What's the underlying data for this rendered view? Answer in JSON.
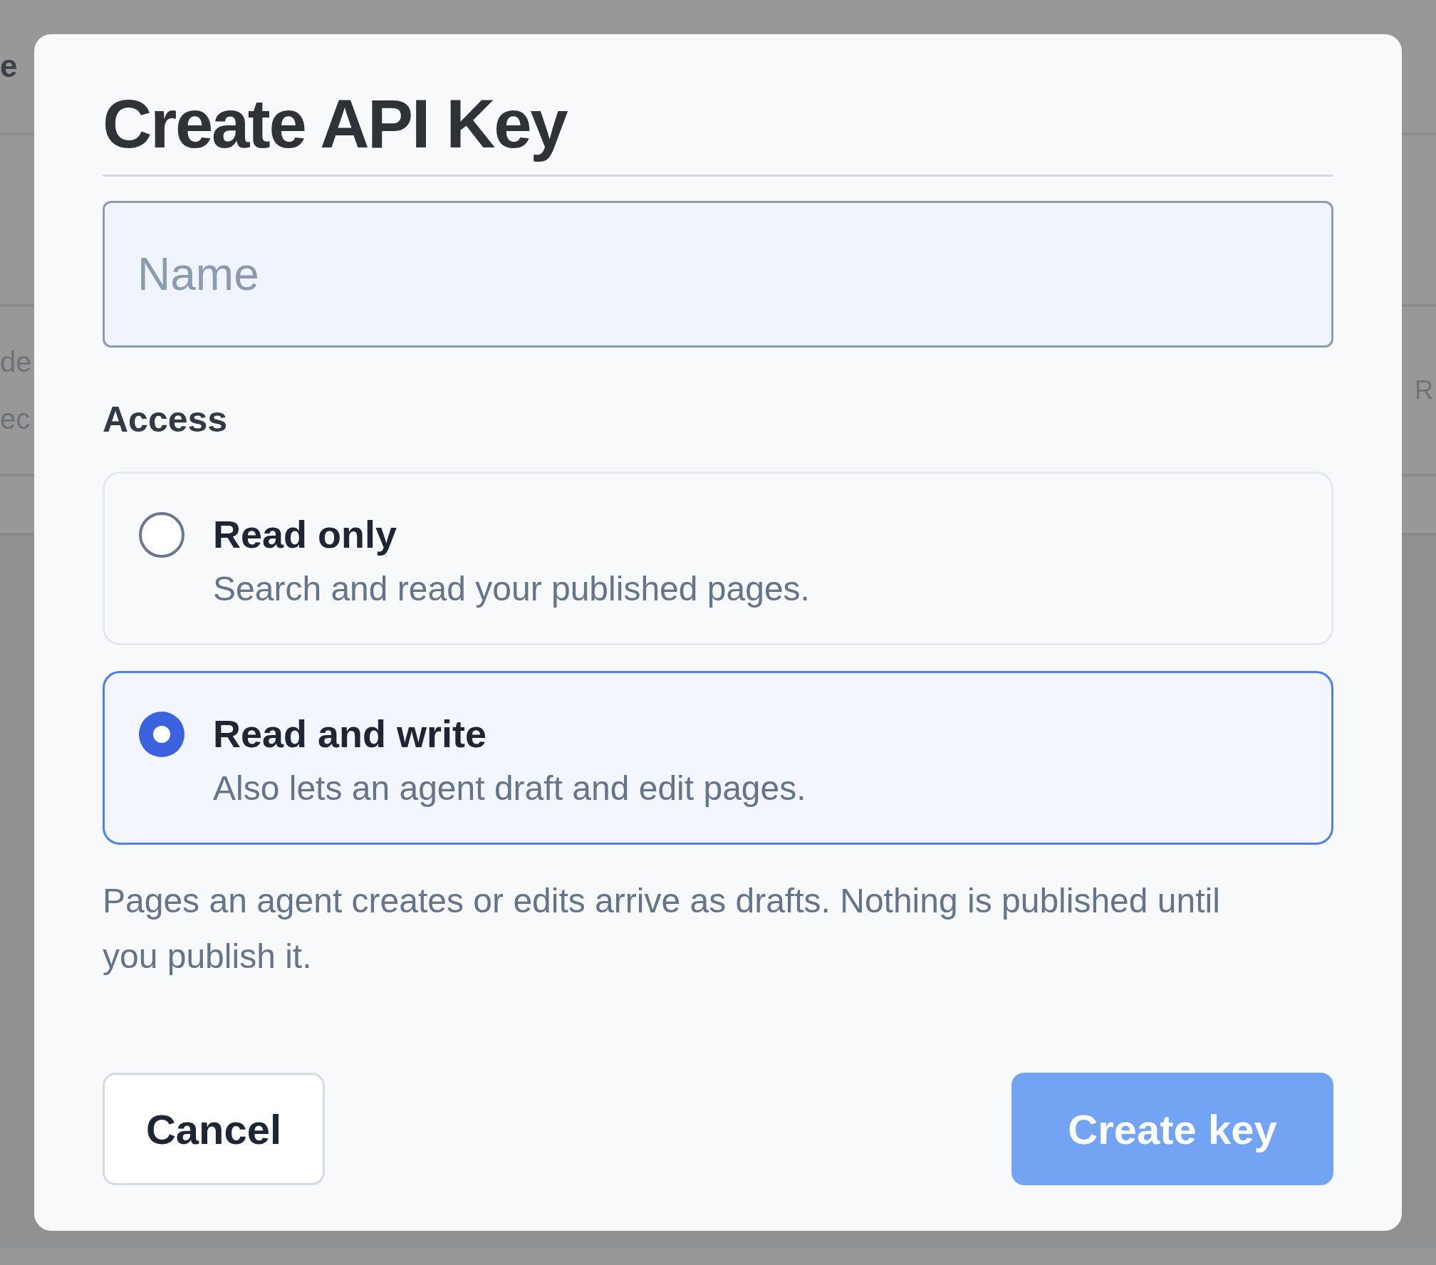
{
  "background": {
    "heading": "e",
    "rows": [
      {
        "left": [
          "de",
          "ec"
        ],
        "right": "R"
      }
    ]
  },
  "dialog": {
    "title": "Create API Key",
    "name_field": {
      "placeholder": "Name"
    },
    "access": {
      "label": "Access",
      "options": [
        {
          "title": "Read only",
          "description": "Search and read your published pages.",
          "selected": false
        },
        {
          "title": "Read and write",
          "description": "Also lets an agent draft and edit pages.",
          "selected": true
        }
      ]
    },
    "note": "Pages an agent creates or edits arrive as drafts. Nothing is published until you publish it.",
    "buttons": [
      {
        "label": "Cancel",
        "kind": "secondary",
        "disabled": false
      },
      {
        "label": "Create key",
        "kind": "primary",
        "disabled": true
      }
    ]
  }
}
